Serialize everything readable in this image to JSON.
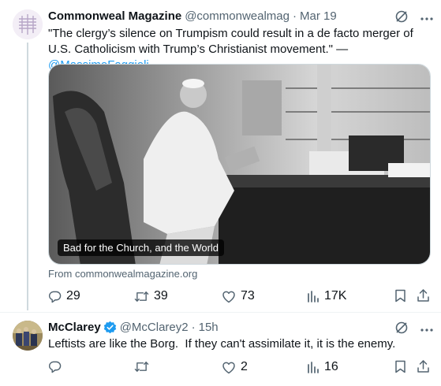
{
  "tweet1": {
    "name": "Commonweal Magazine",
    "handle": "@commonwealmag",
    "separator": "·",
    "time": "Mar 19",
    "text_before": "\"The clergy’s silence on Trumpism could result in a de facto merger of U.S. Catholicism with Trump’s Christianist movement.\" — ",
    "mention": "@MassimoFaggioli",
    "image_caption": "Bad for the Church, and the World",
    "source": "From commonwealmagazine.org",
    "replies": "29",
    "retweets": "39",
    "likes": "73",
    "views": "17K"
  },
  "tweet2": {
    "name": "McClarey",
    "handle": "@McClarey2",
    "separator": "·",
    "time": "15h",
    "text": "Leftists are like the Borg.  If they can't assimilate it, it is the enemy.",
    "replies": "",
    "retweets": "",
    "likes": "2",
    "views": "16"
  },
  "colors": {
    "text": "#0f1419",
    "secondary": "#536471",
    "link": "#1d9bf0",
    "divider": "#eff3f4"
  },
  "icons": [
    "grok-icon",
    "more-icon",
    "reply-icon",
    "retweet-icon",
    "like-icon",
    "views-icon",
    "bookmark-icon",
    "share-icon",
    "verified-badge-icon"
  ]
}
